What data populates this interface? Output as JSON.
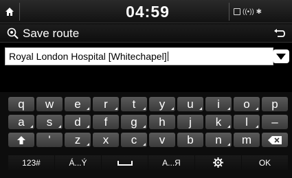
{
  "status_bar": {
    "time": "04:59",
    "indicators": "((•)) ✱"
  },
  "title_bar": {
    "title": "Save route"
  },
  "input": {
    "value": "Royal London Hospital [Whitechapel]"
  },
  "keyboard": {
    "row1": [
      "q",
      "w",
      "e",
      "r",
      "t",
      "y",
      "u",
      "i",
      "o",
      "p"
    ],
    "row2": [
      "a",
      "s",
      "d",
      "f",
      "g",
      "h",
      "j",
      "k",
      "l",
      "–"
    ],
    "row3": [
      "'",
      "z",
      "x",
      "c",
      "v",
      "b",
      "n",
      "m"
    ],
    "mode_123": "123#",
    "accents": "Á...Ý",
    "cyrillic": "А...Я",
    "ok": "OK"
  },
  "colors": {
    "key_face": "#4a4a4a",
    "keyboard_bg": "#0d0d0d",
    "input_bg": "#ffffff"
  }
}
